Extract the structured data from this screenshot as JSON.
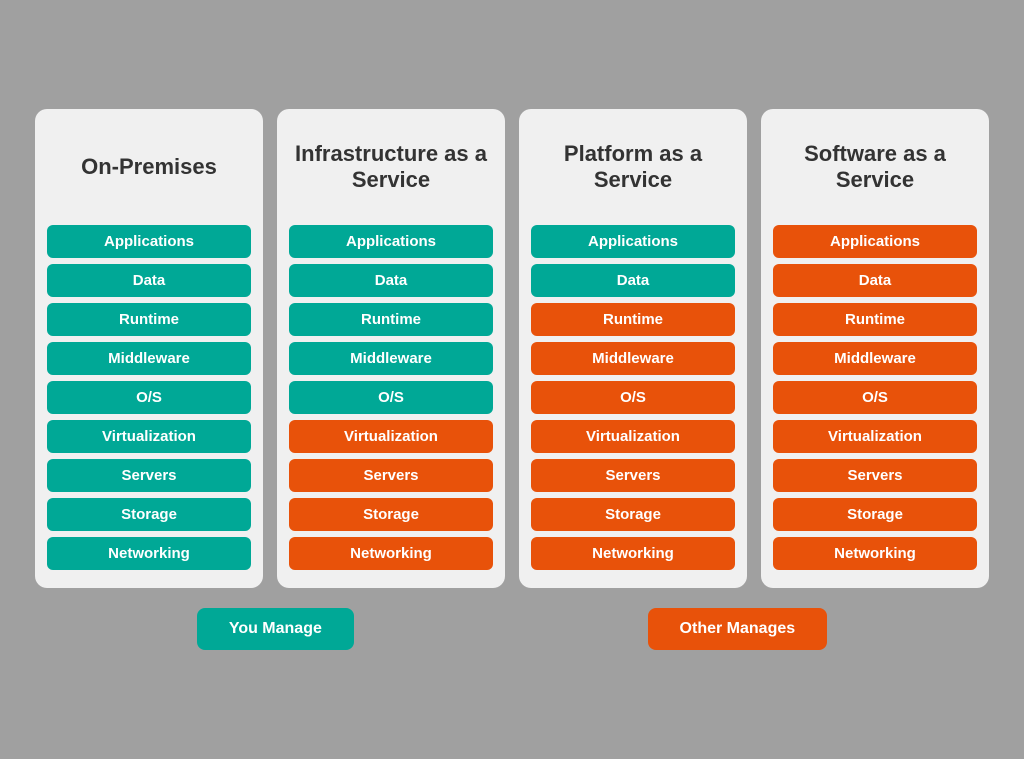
{
  "columns": [
    {
      "title": "On-Premises",
      "items": [
        {
          "label": "Applications",
          "color": "teal"
        },
        {
          "label": "Data",
          "color": "teal"
        },
        {
          "label": "Runtime",
          "color": "teal"
        },
        {
          "label": "Middleware",
          "color": "teal"
        },
        {
          "label": "O/S",
          "color": "teal"
        },
        {
          "label": "Virtualization",
          "color": "teal"
        },
        {
          "label": "Servers",
          "color": "teal"
        },
        {
          "label": "Storage",
          "color": "teal"
        },
        {
          "label": "Networking",
          "color": "teal"
        }
      ]
    },
    {
      "title": "Infrastructure as a Service",
      "items": [
        {
          "label": "Applications",
          "color": "teal"
        },
        {
          "label": "Data",
          "color": "teal"
        },
        {
          "label": "Runtime",
          "color": "teal"
        },
        {
          "label": "Middleware",
          "color": "teal"
        },
        {
          "label": "O/S",
          "color": "teal"
        },
        {
          "label": "Virtualization",
          "color": "orange"
        },
        {
          "label": "Servers",
          "color": "orange"
        },
        {
          "label": "Storage",
          "color": "orange"
        },
        {
          "label": "Networking",
          "color": "orange"
        }
      ]
    },
    {
      "title": "Platform as a Service",
      "items": [
        {
          "label": "Applications",
          "color": "teal"
        },
        {
          "label": "Data",
          "color": "teal"
        },
        {
          "label": "Runtime",
          "color": "orange"
        },
        {
          "label": "Middleware",
          "color": "orange"
        },
        {
          "label": "O/S",
          "color": "orange"
        },
        {
          "label": "Virtualization",
          "color": "orange"
        },
        {
          "label": "Servers",
          "color": "orange"
        },
        {
          "label": "Storage",
          "color": "orange"
        },
        {
          "label": "Networking",
          "color": "orange"
        }
      ]
    },
    {
      "title": "Software as a Service",
      "items": [
        {
          "label": "Applications",
          "color": "orange"
        },
        {
          "label": "Data",
          "color": "orange"
        },
        {
          "label": "Runtime",
          "color": "orange"
        },
        {
          "label": "Middleware",
          "color": "orange"
        },
        {
          "label": "O/S",
          "color": "orange"
        },
        {
          "label": "Virtualization",
          "color": "orange"
        },
        {
          "label": "Servers",
          "color": "orange"
        },
        {
          "label": "Storage",
          "color": "orange"
        },
        {
          "label": "Networking",
          "color": "orange"
        }
      ]
    }
  ],
  "legend": {
    "you_manage": "You Manage",
    "other_manages": "Other Manages"
  }
}
